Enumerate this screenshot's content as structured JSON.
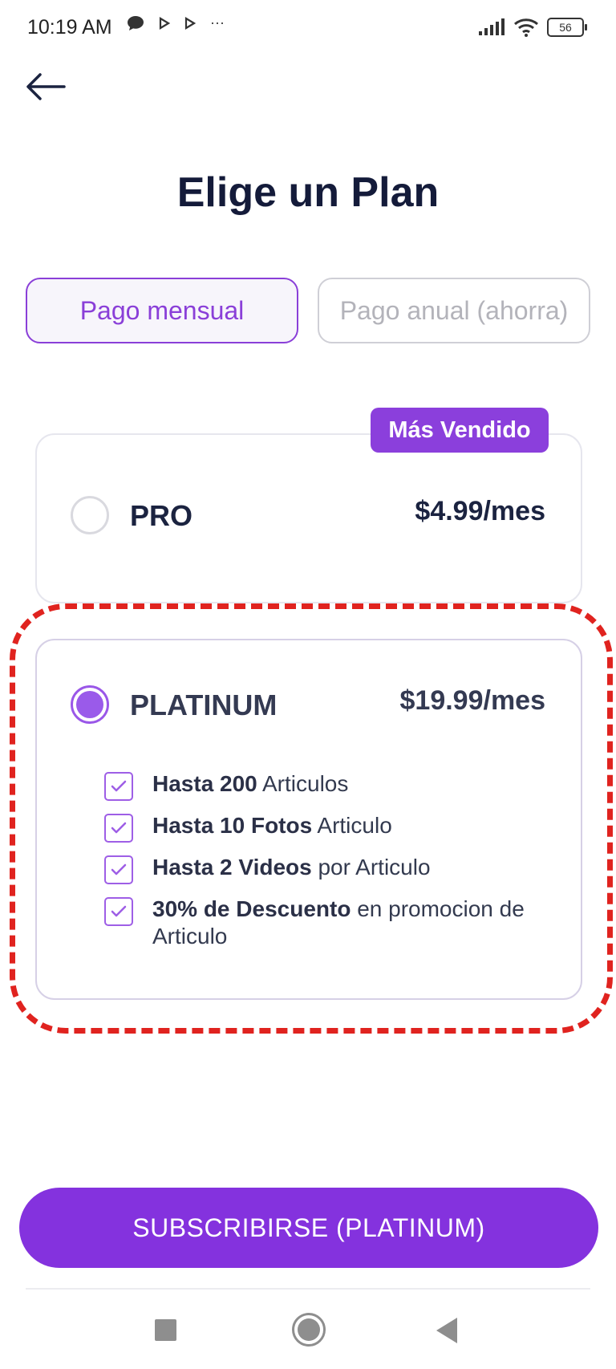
{
  "status_bar": {
    "time": "10:19 AM",
    "notification_icons": [
      "chat-bubble-icon",
      "play-icon",
      "play-icon",
      "more-dots-icon"
    ],
    "more_label": "···",
    "battery": "56"
  },
  "header": {
    "title": "Elige un Plan"
  },
  "billing_toggle": {
    "monthly_label": "Pago mensual",
    "annual_label": "Pago anual (ahorra)",
    "selected": "monthly"
  },
  "plans": {
    "pro": {
      "badge": "Más Vendido",
      "name": "PRO",
      "price": "$4.99/mes",
      "selected": false
    },
    "platinum": {
      "name": "PLATINUM",
      "price": "$19.99/mes",
      "selected": true,
      "features": [
        {
          "bold": "Hasta 200",
          "rest": " Articulos"
        },
        {
          "bold": "Hasta 10 Fotos",
          "rest": " Articulo"
        },
        {
          "bold": "Hasta 2 Videos",
          "rest": " por Articulo"
        },
        {
          "bold": "30% de Descuento",
          "rest": " en promocion de Articulo"
        }
      ]
    }
  },
  "cta": {
    "label": "SUBSCRIBIRSE (PLATINUM)"
  },
  "colors": {
    "accent": "#8432de",
    "highlight_outline": "#e0231f"
  }
}
